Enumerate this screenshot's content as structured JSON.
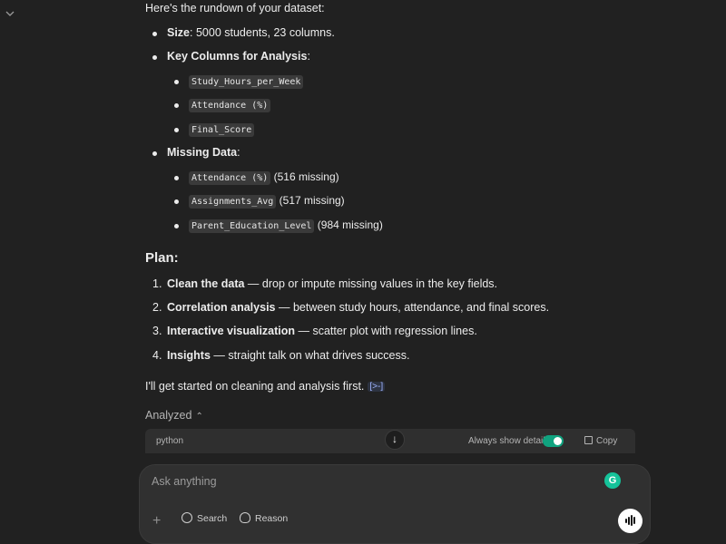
{
  "intro": "Here's the rundown of your dataset:",
  "dataset": {
    "size_label": "Size",
    "size_value": ": 5000 students, 23 columns.",
    "key_columns_label": "Key Columns for Analysis",
    "key_columns_colon": ":",
    "key_columns": [
      "Study_Hours_per_Week",
      "Attendance (%)",
      "Final_Score"
    ],
    "missing_label": "Missing Data",
    "missing_colon": ":",
    "missing": [
      {
        "col": "Attendance (%)",
        "note": " (516 missing)"
      },
      {
        "col": "Assignments_Avg",
        "note": " (517 missing)"
      },
      {
        "col": "Parent_Education_Level",
        "note": " (984 missing)"
      }
    ]
  },
  "plan": {
    "heading": "Plan:",
    "steps": [
      {
        "num": "1.",
        "title": "Clean the data",
        "desc": " — drop or impute missing values in the key fields."
      },
      {
        "num": "2.",
        "title": "Correlation analysis",
        "desc": " — between study hours, attendance, and final scores."
      },
      {
        "num": "3.",
        "title": "Interactive visualization",
        "desc": " — scatter plot with regression lines."
      },
      {
        "num": "4.",
        "title": "Insights",
        "desc": " — straight talk on what drives success."
      }
    ]
  },
  "closing": "I'll get started on cleaning and analysis first.",
  "cite_label": "[>-]",
  "analyzed_label": "Analyzed",
  "code_block": {
    "language": "python",
    "toggle_label": "Always show details",
    "toggle_on": true,
    "copy_label": "Copy"
  },
  "composer": {
    "placeholder": "Ask anything",
    "search_label": "Search",
    "reason_label": "Reason"
  },
  "colors": {
    "background": "#212121",
    "toggle_on": "#10a37f",
    "grammarly": "#15c39a"
  }
}
